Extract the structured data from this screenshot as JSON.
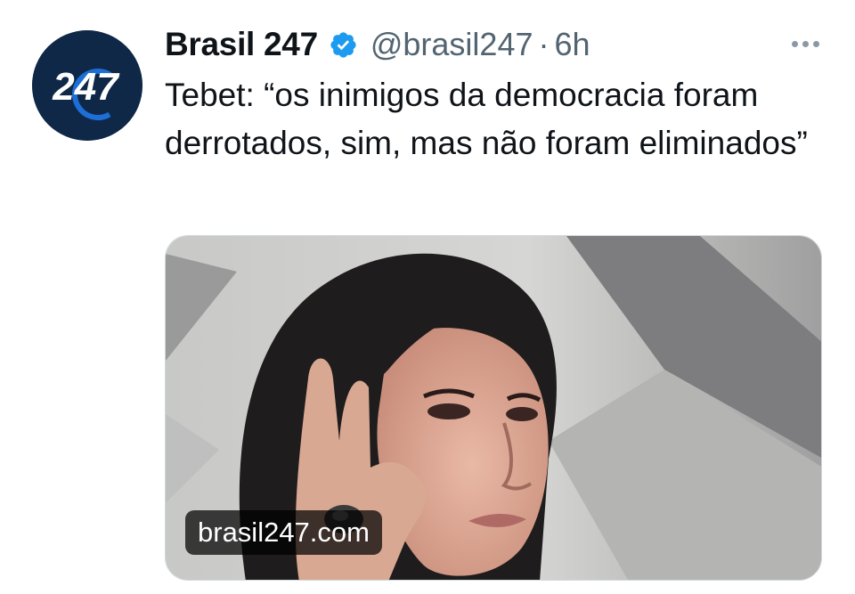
{
  "tweet": {
    "display_name": "Brasil 247",
    "handle": "@brasil247",
    "separator": "·",
    "time": "6h",
    "text": "Tebet: “os inimigos da democracia foram derrotados, sim, mas não foram eliminados”",
    "avatar_logo": "247",
    "icons": {
      "verified": "verified-badge-icon",
      "more": "more-options-icon"
    },
    "media": {
      "domain": "brasil247.com"
    }
  },
  "colors": {
    "verified_blue": "#1d9bf0",
    "text": "#0f1419",
    "secondary_text": "#536471",
    "avatar_bg": "#0f2848"
  }
}
